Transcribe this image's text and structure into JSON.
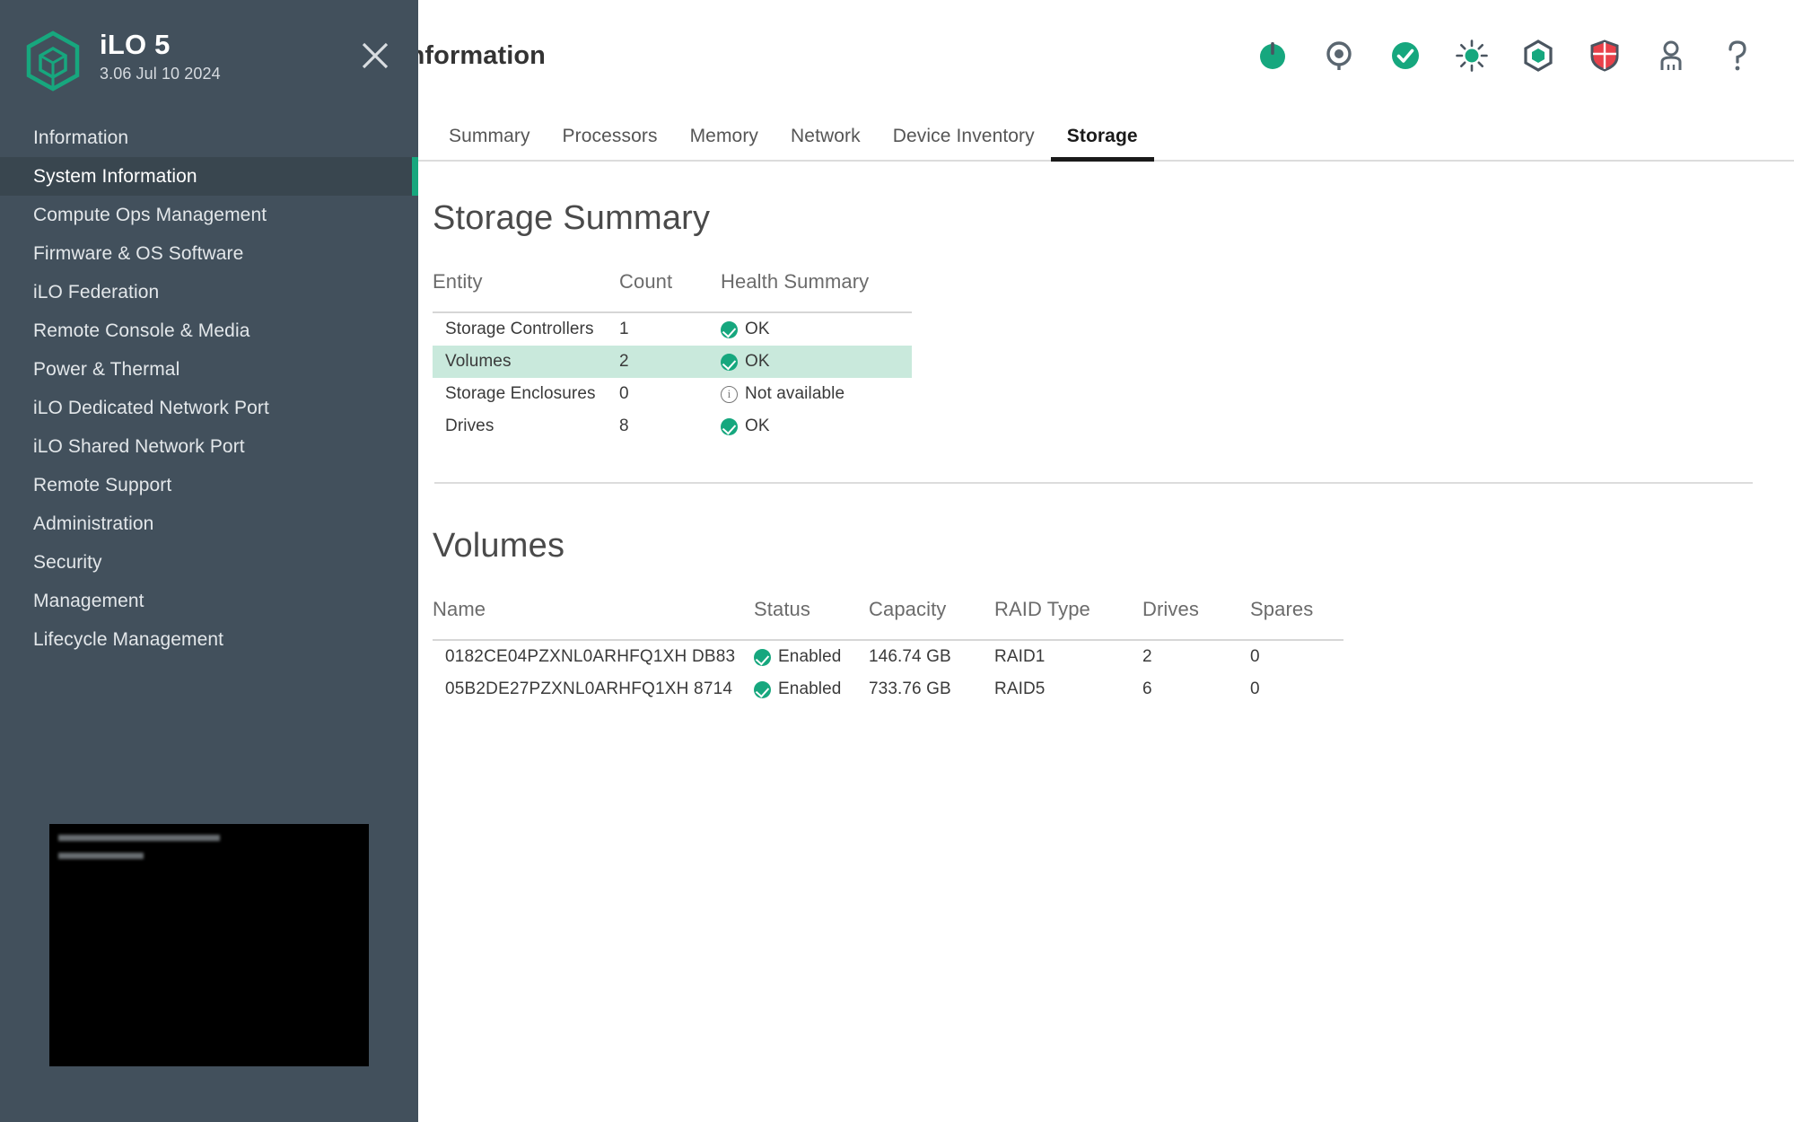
{
  "sidebar": {
    "brand": {
      "title": "iLO 5",
      "version": "3.06 Jul 10 2024",
      "logo_icon": "hexagon-cube-icon",
      "close_icon": "close-icon"
    },
    "items": [
      {
        "label": "Information",
        "active": false
      },
      {
        "label": "System Information",
        "active": true
      },
      {
        "label": "Compute Ops Management",
        "active": false
      },
      {
        "label": "Firmware & OS Software",
        "active": false
      },
      {
        "label": "iLO Federation",
        "active": false
      },
      {
        "label": "Remote Console & Media",
        "active": false
      },
      {
        "label": "Power & Thermal",
        "active": false
      },
      {
        "label": "iLO Dedicated Network Port",
        "active": false
      },
      {
        "label": "iLO Shared Network Port",
        "active": false
      },
      {
        "label": "Remote Support",
        "active": false
      },
      {
        "label": "Administration",
        "active": false
      },
      {
        "label": "Security",
        "active": false
      },
      {
        "label": "Management",
        "active": false
      },
      {
        "label": "Lifecycle Management",
        "active": false
      }
    ],
    "console_preview": {
      "name": "remote-console-thumbnail",
      "background": "#000000"
    }
  },
  "header": {
    "title": "System Information - Storage Information",
    "icons": [
      {
        "name": "power-status-icon",
        "title": "Power"
      },
      {
        "name": "uid-indicator-icon",
        "title": "UID Indicator"
      },
      {
        "name": "health-ok-icon",
        "title": "Health OK"
      },
      {
        "name": "uid-light-icon",
        "title": "UID Light"
      },
      {
        "name": "hexagon-status-icon",
        "title": "Status"
      },
      {
        "name": "security-shield-icon",
        "title": "Security"
      },
      {
        "name": "user-account-icon",
        "title": "User"
      },
      {
        "name": "help-icon",
        "title": "Help"
      }
    ]
  },
  "tabs": [
    {
      "label": "Summary",
      "active": false
    },
    {
      "label": "Processors",
      "active": false
    },
    {
      "label": "Memory",
      "active": false
    },
    {
      "label": "Network",
      "active": false
    },
    {
      "label": "Device Inventory",
      "active": false
    },
    {
      "label": "Storage",
      "active": true
    }
  ],
  "storage_summary": {
    "heading": "Storage Summary",
    "columns": [
      "Entity",
      "Count",
      "Health Summary"
    ],
    "rows": [
      {
        "entity": "Storage Controllers",
        "count": "1",
        "health": "OK",
        "health_icon": "ok-icon",
        "highlight": false
      },
      {
        "entity": "Volumes",
        "count": "2",
        "health": "OK",
        "health_icon": "ok-icon",
        "highlight": true
      },
      {
        "entity": "Storage Enclosures",
        "count": "0",
        "health": "Not available",
        "health_icon": "info-icon",
        "highlight": false
      },
      {
        "entity": "Drives",
        "count": "8",
        "health": "OK",
        "health_icon": "ok-icon",
        "highlight": false
      }
    ]
  },
  "volumes": {
    "heading": "Volumes",
    "columns": [
      "Name",
      "Status",
      "Capacity",
      "RAID Type",
      "Drives",
      "Spares"
    ],
    "rows": [
      {
        "name": "0182CE04PZXNL0ARHFQ1XH DB83",
        "status": "Enabled",
        "status_icon": "ok-icon",
        "capacity": "146.74 GB",
        "raid_type": "RAID1",
        "drives": "2",
        "spares": "0"
      },
      {
        "name": "05B2DE27PZXNL0ARHFQ1XH 8714",
        "status": "Enabled",
        "status_icon": "ok-icon",
        "capacity": "733.76 GB",
        "raid_type": "RAID5",
        "drives": "6",
        "spares": "0"
      }
    ]
  },
  "colors": {
    "sidebar_bg": "#42505C",
    "sidebar_active_bg": "#39464F",
    "accent_green": "#17A77E",
    "row_highlight": "#C9E9DC",
    "status_red": "#E8414A"
  }
}
